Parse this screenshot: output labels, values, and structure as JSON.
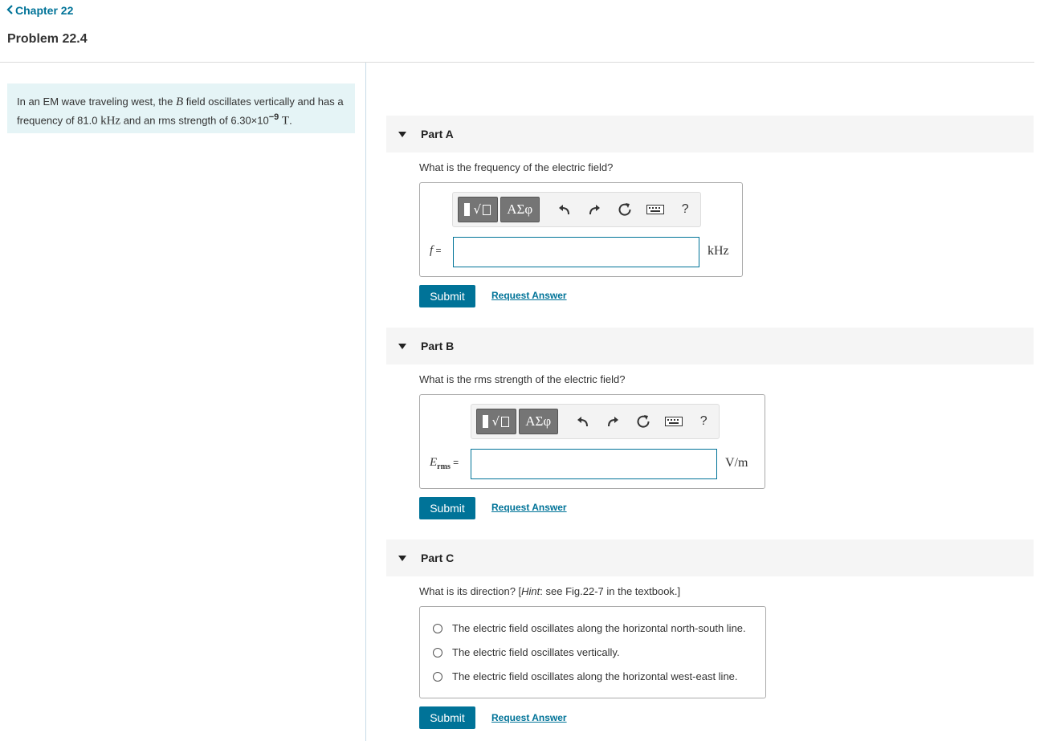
{
  "nav": {
    "back_label": "Chapter 22"
  },
  "problem": {
    "title": "Problem 22.4"
  },
  "intro": {
    "text1": "In an EM wave traveling west, the ",
    "b_symbol": "B",
    "text2": " field oscillates vertically and has a frequency of 81.0 ",
    "freq_unit": "kHz",
    "text3": " and an rms strength of 6.30×10",
    "exponent": "−9",
    "text4": " ",
    "b_unit": "T",
    "text5": "."
  },
  "toolbar": {
    "greek_label": "ΑΣφ",
    "help_label": "?"
  },
  "parts": [
    {
      "label": "Part A",
      "question": "What is the frequency of the electric field?",
      "var_symbol": "f",
      "var_sub": "",
      "eq": " =",
      "unit": "kHz",
      "submit": "Submit",
      "request": "Request Answer"
    },
    {
      "label": "Part B",
      "question": "What is the rms strength of the electric field?",
      "var_symbol": "E",
      "var_sub": "rms",
      "eq": " =",
      "unit": "V/m",
      "submit": "Submit",
      "request": "Request Answer"
    },
    {
      "label": "Part C",
      "question_main": "What is its direction? [",
      "hint_label": "Hint",
      "question_rest": ": see Fig.22-7 in the textbook.]",
      "options": [
        "The electric field oscillates along the horizontal north-south line.",
        "The electric field oscillates vertically.",
        "The electric field oscillates along the horizontal west-east line."
      ],
      "submit": "Submit",
      "request": "Request Answer"
    }
  ],
  "colors": {
    "accent": "#007398",
    "intro_bg": "#e5f4f6",
    "part_header_bg": "#f5f5f5"
  },
  "icons": [
    "chevron-left-icon",
    "collapse-triangle-icon",
    "undo-icon",
    "redo-icon",
    "reset-icon",
    "keyboard-icon",
    "help-icon"
  ]
}
